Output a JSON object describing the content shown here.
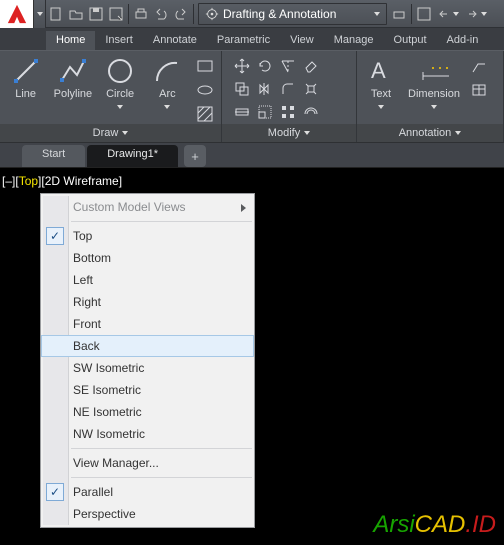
{
  "qat": {
    "workspace_label": "Drafting & Annotation"
  },
  "ribbon": {
    "tabs": [
      "Home",
      "Insert",
      "Annotate",
      "Parametric",
      "View",
      "Manage",
      "Output",
      "Add-in"
    ],
    "draw": {
      "line": "Line",
      "polyline": "Polyline",
      "circle": "Circle",
      "arc": "Arc",
      "title": "Draw"
    },
    "modify": {
      "title": "Modify"
    },
    "annotation": {
      "text": "Text",
      "dimension": "Dimension",
      "title": "Annotation"
    }
  },
  "doc_tabs": {
    "start": "Start",
    "drawing": "Drawing1*"
  },
  "viewport": {
    "lbr": "[–][",
    "top": "Top",
    "rest": "][2D Wireframe]"
  },
  "menu": {
    "header": "Custom Model Views",
    "top": "Top",
    "bottom": "Bottom",
    "left": "Left",
    "right": "Right",
    "front": "Front",
    "back": "Back",
    "sw": "SW Isometric",
    "se": "SE Isometric",
    "ne": "NE Isometric",
    "nw": "NW Isometric",
    "vm": "View Manager...",
    "parallel": "Parallel",
    "perspective": "Perspective"
  },
  "watermark": {
    "p1": "Arsi",
    "p2": "CAD",
    "p3": ".ID"
  }
}
